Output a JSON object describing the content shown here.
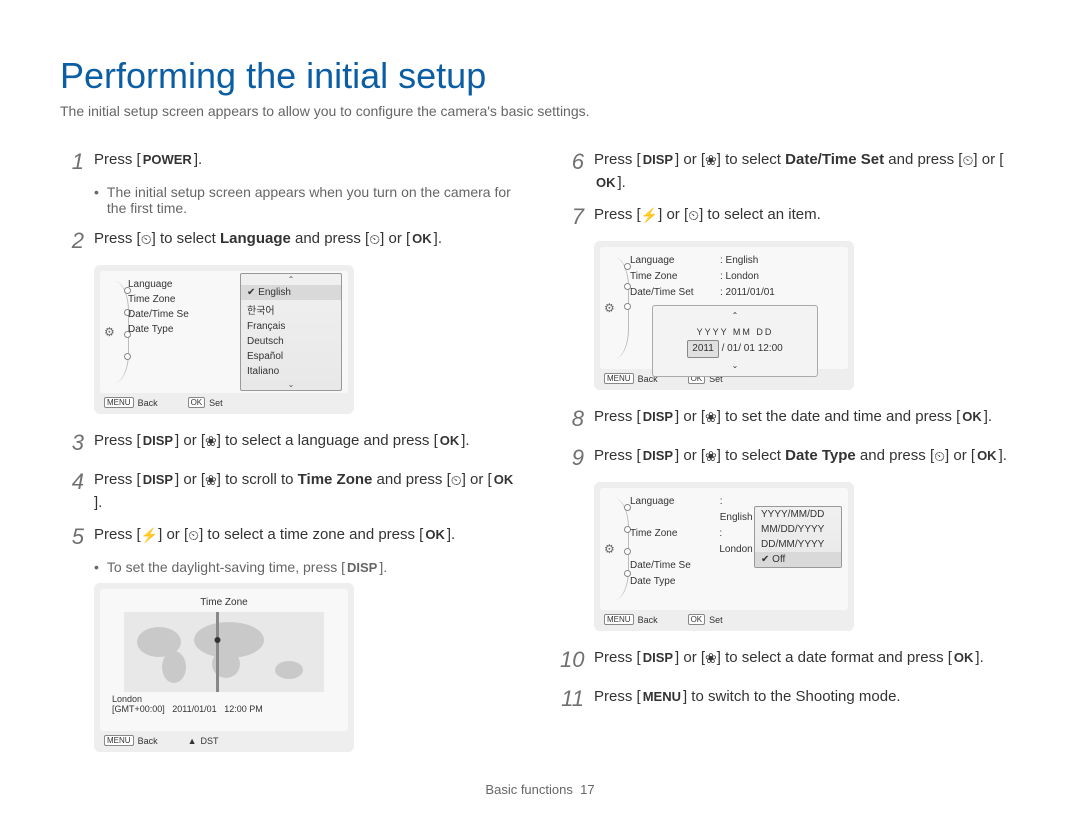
{
  "heading": "Performing the initial setup",
  "intro": "The initial setup screen appears to allow you to configure the camera's basic settings.",
  "keys": {
    "power": "POWER",
    "disp": "DISP",
    "ok": "OK",
    "menu": "MENU"
  },
  "icons": {
    "timer": "⏲",
    "macro": "❀",
    "flash": "⚡",
    "ok": "OK",
    "up": "▲",
    "check": "✔",
    "gear": "⚙"
  },
  "steps": {
    "1": {
      "text_before": "Press [",
      "text_after": "]."
    },
    "1_bullet": "The initial setup screen appears when you turn on the camera for the first time.",
    "2": {
      "pre": "Press [",
      "mid1": "] to select ",
      "bold1": "Language",
      "mid2": " and press [",
      "mid3": "] or ["
    },
    "3": "] to select a language and press [",
    "4": {
      "mid": "] to scroll to ",
      "bold": "Time Zone",
      "after": " and press"
    },
    "5": "] to select a time zone and press [",
    "5_bullet": "To set the daylight-saving time, press [",
    "6": {
      "mid": "] to select ",
      "bold": "Date/Time Set",
      "after": " and press"
    },
    "7": "] to select an item.",
    "8": "] to set the date and time and press [",
    "9": {
      "mid": "] to select ",
      "bold": "Date Type",
      "after": " and press"
    },
    "10": "] to select a date format and press [",
    "11": "] to switch to the Shooting mode."
  },
  "lcd1": {
    "menu": [
      "Language",
      "Time Zone",
      "Date/Time Se",
      "Date Type"
    ],
    "options": [
      "English",
      "한국어",
      "Français",
      "Deutsch",
      "Español",
      "Italiano"
    ],
    "selected_index": 0,
    "footer_back": "Back",
    "footer_set": "Set",
    "footer_menu_key": "MENU",
    "footer_ok_key": "OK"
  },
  "lcd_tz": {
    "title": "Time Zone",
    "city": "London",
    "gmt": "[GMT+00:00]",
    "date": "2011/01/01",
    "time": "12:00 PM",
    "footer_back": "Back",
    "footer_dst": "DST",
    "footer_menu_key": "MENU"
  },
  "lcd_date": {
    "rows": [
      {
        "k": "Language",
        "v": ": English"
      },
      {
        "k": "Time Zone",
        "v": ": London"
      },
      {
        "k": "Date/Time Set",
        "v": ": 2011/01/01"
      }
    ],
    "header": "YYYY MM DD",
    "year": "2011",
    "rest": "/ 01/ 01  12:00",
    "footer_back": "Back",
    "footer_set": "Set",
    "footer_menu_key": "MENU",
    "footer_ok_key": "OK"
  },
  "lcd_type": {
    "rows": [
      {
        "k": "Language",
        "v": ": English"
      },
      {
        "k": "Time Zone",
        "v": ": London"
      },
      {
        "k": "Date/Time Se",
        "v": ""
      },
      {
        "k": "Date Type",
        "v": ""
      }
    ],
    "options": [
      "YYYY/MM/DD",
      "MM/DD/YYYY",
      "DD/MM/YYYY",
      "Off"
    ],
    "selected_index": 3,
    "footer_back": "Back",
    "footer_set": "Set",
    "footer_menu_key": "MENU",
    "footer_ok_key": "OK"
  },
  "footer": {
    "section": "Basic functions",
    "page": "17"
  }
}
